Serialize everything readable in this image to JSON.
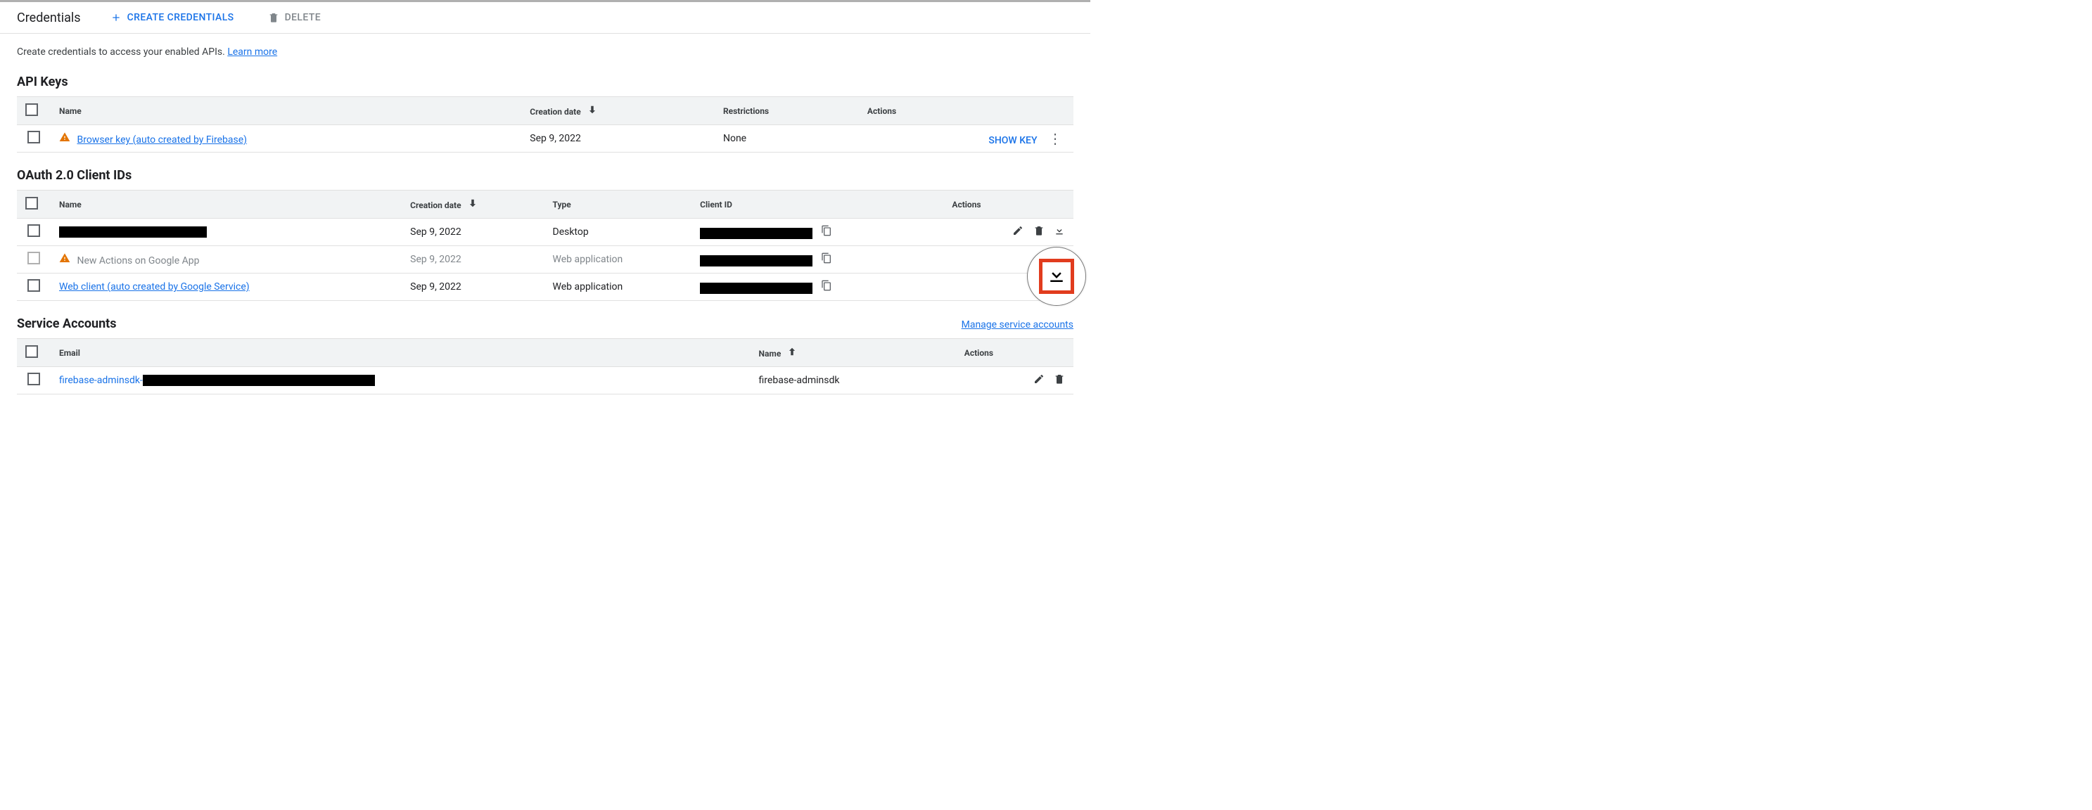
{
  "header": {
    "title": "Credentials",
    "create_label": "CREATE CREDENTIALS",
    "delete_label": "DELETE"
  },
  "intro": {
    "text": "Create credentials to access your enabled APIs. ",
    "learn_more": "Learn more"
  },
  "tables": {
    "actions_header": "Actions"
  },
  "api_keys": {
    "title": "API Keys",
    "cols": {
      "name": "Name",
      "created": "Creation date",
      "restrictions": "Restrictions"
    },
    "rows": [
      {
        "warn": true,
        "name": "Browser key (auto created by Firebase)",
        "created": "Sep 9, 2022",
        "restrictions": "None",
        "show_key": "SHOW KEY"
      }
    ]
  },
  "oauth": {
    "title": "OAuth 2.0 Client IDs",
    "cols": {
      "name": "Name",
      "created": "Creation date",
      "type": "Type",
      "client_id": "Client ID"
    },
    "rows": [
      {
        "warn": false,
        "disabled": false,
        "name_redacted": true,
        "name": "",
        "created": "Sep 9, 2022",
        "type": "Desktop",
        "client_id_redacted": true,
        "show_copy": true,
        "show_edit_delete_download": true
      },
      {
        "warn": true,
        "disabled": true,
        "name_redacted": false,
        "name": "New Actions on Google App",
        "created": "Sep 9, 2022",
        "type": "Web application",
        "client_id_redacted": true,
        "show_copy": true,
        "show_edit_delete_download": false
      },
      {
        "warn": false,
        "disabled": false,
        "name_redacted": false,
        "name": "Web client (auto created by Google Service)",
        "created": "Sep 9, 2022",
        "type": "Web application",
        "client_id_redacted": true,
        "show_copy": true,
        "show_edit_delete_download": true,
        "link": true
      }
    ]
  },
  "svc": {
    "title": "Service Accounts",
    "manage_link": "Manage service accounts",
    "cols": {
      "email": "Email",
      "name": "Name"
    },
    "rows": [
      {
        "email_prefix": "firebase-adminsdk-",
        "email_redacted_tail": true,
        "name": "firebase-adminsdk"
      }
    ]
  }
}
